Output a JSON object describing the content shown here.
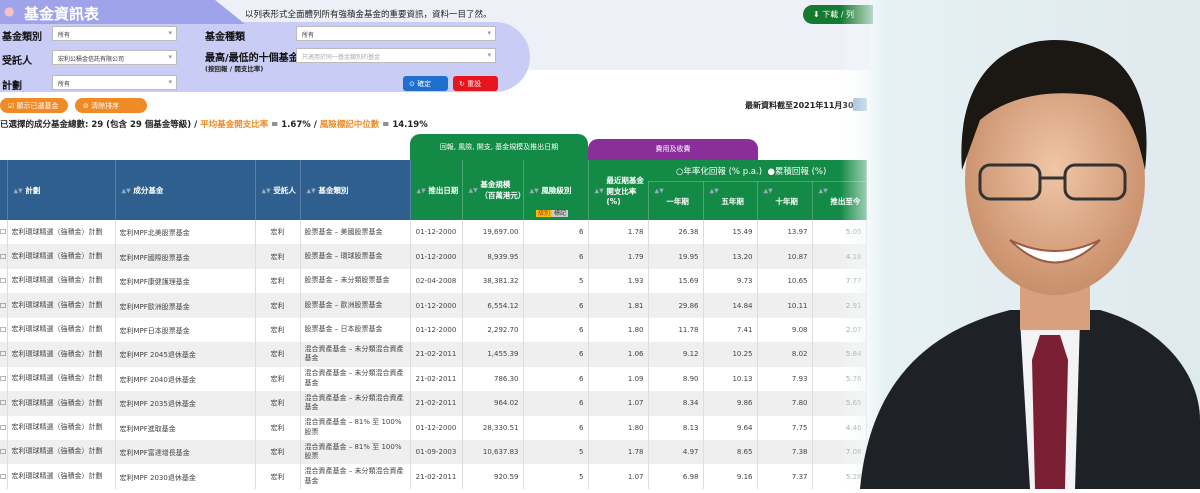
{
  "header": {
    "title": "基金資訊表",
    "tagline": "以列表形式全面體列所有強積金基金的重要資訊，資料一目了然。",
    "download_label": "下載 / 列"
  },
  "filters": {
    "fund_type_label": "基金類別",
    "fund_type_value": "所有",
    "fund_kind_label": "基金種類",
    "fund_kind_value": "所有",
    "trustee_label": "受託人",
    "trustee_value": "宏利公積金信託有限公司",
    "top_label": "最高/最低的十個基金",
    "top_sublabel": "(按回報 / 開支比率)",
    "top_placeholder": "只適用於同一基金類別的基金",
    "scheme_label": "計劃",
    "scheme_value": "所有",
    "confirm_label": "確定",
    "reset_label": "重設"
  },
  "actions": {
    "show_selected": "顯示已選基金",
    "clear_sort": "清除排序"
  },
  "summary": {
    "prefix": "已選擇的成分基金總數: 29 (包含 29 個基金等級) / ",
    "fer_label": "平均基金開支比率",
    "fer_value": " = 1.67% / ",
    "risk_label": "風險標記中位數",
    "risk_value": " = 14.19%",
    "as_of": "最新資料截至2021年11月30日"
  },
  "groups": {
    "returns_risk": "回報, 風險, 開支, 基金規模及推出日期",
    "fees": "費用及收費",
    "annualised": "○年率化回報 (% p.a.)",
    "cumulative": "●累積回報 (%)"
  },
  "columns": [
    "計劃",
    "成分基金",
    "受託人",
    "基金類別",
    "推出日期",
    "基金規模（百萬港元）",
    "風險級別",
    "最近期基金開支比率 (%)",
    "一年期",
    "五年期",
    "十年期",
    "推出至今"
  ],
  "risk_tags": [
    "級別",
    "標記"
  ],
  "colors": {
    "header_blue": "#2f5f8f",
    "group_green": "#138a45",
    "fees_purple": "#8a2f9a",
    "accent_orange": "#f08a24"
  },
  "rows": [
    [
      "宏利環球精選（強積金）計劃",
      "宏利MPF北美股票基金",
      "宏利",
      "股票基金 – 美國股票基金",
      "01-12-2000",
      "19,697.00",
      "6",
      "1.78",
      "26.38",
      "15.49",
      "13.97",
      "5.05"
    ],
    [
      "宏利環球精選（強積金）計劃",
      "宏利MPF國際股票基金",
      "宏利",
      "股票基金 – 環球股票基金",
      "01-12-2000",
      "8,939.95",
      "6",
      "1.79",
      "19.95",
      "13.20",
      "10.87",
      "4.18"
    ],
    [
      "宏利環球精選（強積金）計劃",
      "宏利MPF康健護理基金",
      "宏利",
      "股票基金 – 未分類股票基金",
      "02-04-2008",
      "38,381.32",
      "5",
      "1.93",
      "15.69",
      "9.73",
      "10.65",
      "7.77"
    ],
    [
      "宏利環球精選（強積金）計劃",
      "宏利MPF歐洲股票基金",
      "宏利",
      "股票基金 – 歐洲股票基金",
      "01-12-2000",
      "6,554.12",
      "6",
      "1.81",
      "29.86",
      "14.84",
      "10.11",
      "2.91"
    ],
    [
      "宏利環球精選（強積金）計劃",
      "宏利MPF日本股票基金",
      "宏利",
      "股票基金 – 日本股票基金",
      "01-12-2000",
      "2,292.70",
      "6",
      "1.80",
      "11.78",
      "7.41",
      "9.08",
      "2.07"
    ],
    [
      "宏利環球精選（強積金）計劃",
      "宏利MPF 2045退休基金",
      "宏利",
      "混合資產基金 – 未分類混合資產基金",
      "21-02-2011",
      "1,455.39",
      "6",
      "1.06",
      "9.12",
      "10.25",
      "8.02",
      "5.84"
    ],
    [
      "宏利環球精選（強積金）計劃",
      "宏利MPF 2040退休基金",
      "宏利",
      "混合資產基金 – 未分類混合資產基金",
      "21-02-2011",
      "786.30",
      "6",
      "1.09",
      "8.90",
      "10.13",
      "7.93",
      "5.76"
    ],
    [
      "宏利環球精選（強積金）計劃",
      "宏利MPF 2035退休基金",
      "宏利",
      "混合資產基金 – 未分類混合資產基金",
      "21-02-2011",
      "964.02",
      "6",
      "1.07",
      "8.34",
      "9.86",
      "7.80",
      "5.65"
    ],
    [
      "宏利環球精選（強積金）計劃",
      "宏利MPF進取基金",
      "宏利",
      "混合資產基金 – 81% 至 100% 股票",
      "01-12-2000",
      "28,330.51",
      "6",
      "1.80",
      "8.13",
      "9.64",
      "7.75",
      "4.46"
    ],
    [
      "宏利環球精選（強積金）計劃",
      "宏利MPF富達增長基金",
      "宏利",
      "混合資產基金 – 81% 至 100% 股票",
      "01-09-2003",
      "10,637.83",
      "5",
      "1.78",
      "4.97",
      "8.65",
      "7.38",
      "7.08"
    ],
    [
      "宏利環球精選（強積金）計劃",
      "宏利MPF 2030退休基金",
      "宏利",
      "混合資產基金 – 未分類混合資產基金",
      "21-02-2011",
      "920.59",
      "5",
      "1.07",
      "6.98",
      "9.16",
      "7.37",
      "5.28"
    ]
  ]
}
